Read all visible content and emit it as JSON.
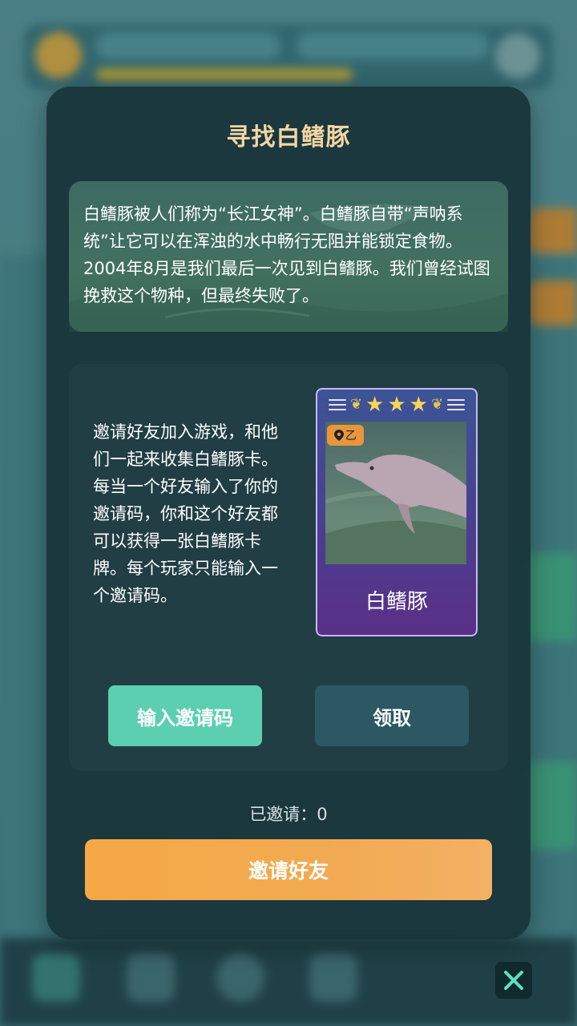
{
  "title": "寻找白鳍豚",
  "intro": "白鳍豚被人们称为“长江女神”。白鳍豚自带“声呐系统”让它可以在浑浊的水中畅行无阻并能锁定食物。2004年8月是我们最后一次见到白鳍豚。我们曾经试图挽救这个物种，但最终失败了。",
  "invite_description": "邀请好友加入游戏，和他们一起来收集白鳍豚卡。每当一个好友输入了你的邀请码，你和这个好友都可以获得一张白鳍豚卡牌。每个玩家只能输入一个邀请码。",
  "card": {
    "name": "白鳍豚",
    "stars": 3,
    "location_tag": "乙",
    "location_icon": "location-pin-icon",
    "frame_color": "#4a3f8f",
    "star_color": "#f7d55a"
  },
  "buttons": {
    "enter_code": "输入邀请码",
    "claim": "领取",
    "invite_friends": "邀请好友"
  },
  "invited_count": "已邀请：0",
  "close_icon": "close-icon",
  "colors": {
    "accent_green": "#5ccfb0",
    "accent_orange": "#f5a845",
    "title_gold": "#f2d6a2"
  }
}
